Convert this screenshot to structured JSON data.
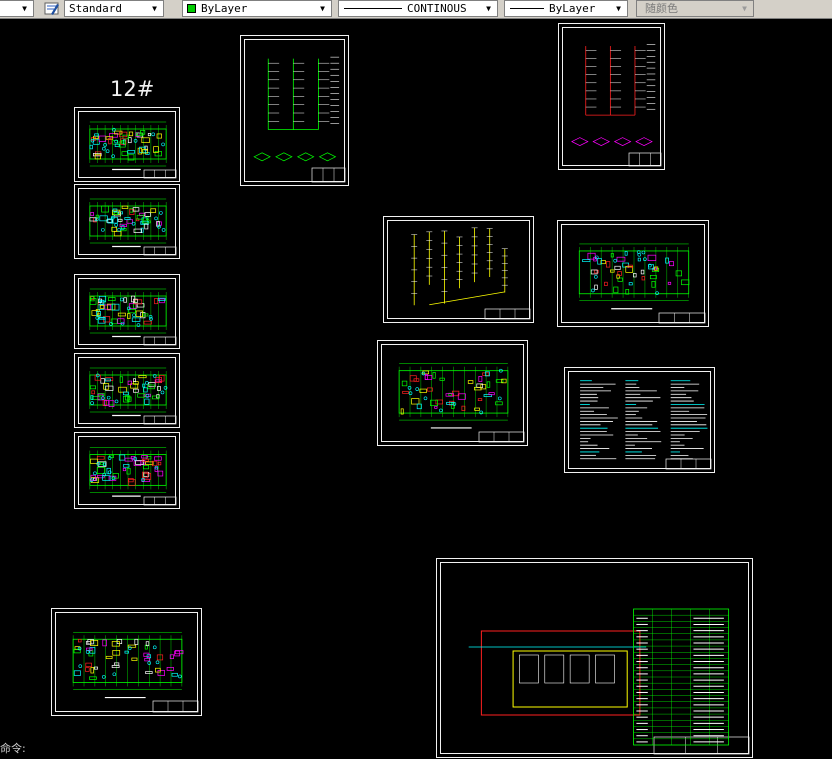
{
  "toolbar": {
    "textstyle_value": "Standard",
    "color_value": "ByLayer",
    "color_swatch": "#00cc00",
    "linetype_value": "CONTINOUS",
    "lineweight_value": "ByLayer",
    "plotstyle_value": "随颜色"
  },
  "canvas": {
    "building_label": "12#",
    "command_prompt": "命令:"
  },
  "colors": {
    "background": "#000000",
    "frame": "#f2f2f2",
    "green": "#00ff00",
    "cyan": "#00ffff",
    "yellow": "#ffff00",
    "red": "#ff2020",
    "magenta": "#ff00ff",
    "white": "#ffffff"
  }
}
